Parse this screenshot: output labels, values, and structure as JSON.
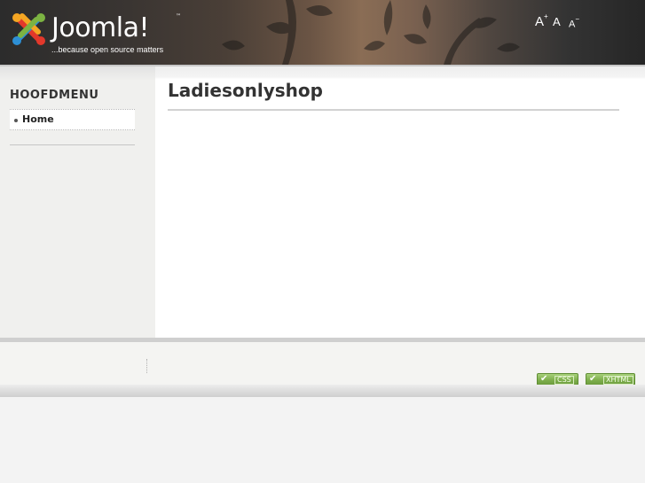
{
  "header": {
    "logo_word": "Joomla!",
    "logo_tm": "™",
    "logo_tagline": "...because open source matters",
    "font_controls": {
      "increase": "A",
      "increase_sign": "+",
      "reset": "A",
      "decrease": "A",
      "decrease_sign": "−"
    }
  },
  "sidebar": {
    "menu_title": "HOOFDMENU",
    "items": [
      {
        "label": "Home"
      }
    ]
  },
  "main": {
    "title": "Ladiesonlyshop"
  },
  "footer": {
    "badges": [
      {
        "label": "CSS",
        "icon": "check-icon"
      },
      {
        "label": "XHTML",
        "icon": "check-icon"
      }
    ]
  },
  "colors": {
    "header_dark": "#2c2c2c",
    "sidebar_bg": "#f0f0ee",
    "badge_green": "#7fb04e",
    "logo_red": "#e2382b",
    "logo_orange": "#f5a623",
    "logo_green": "#7cb342",
    "logo_blue": "#2d8fd5"
  }
}
